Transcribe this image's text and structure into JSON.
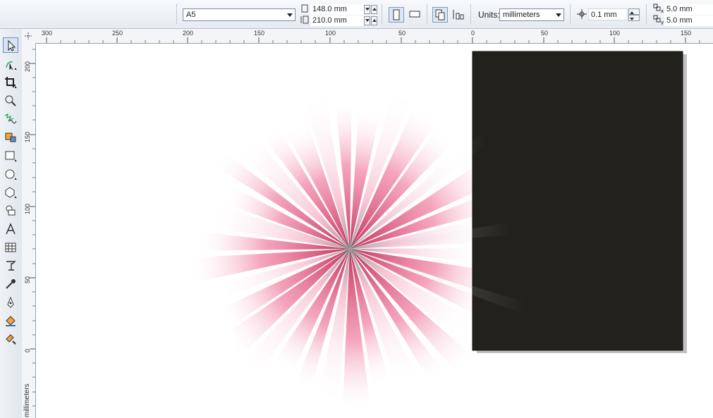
{
  "property_bar": {
    "paper_size": "A5",
    "page_width": "148.0 mm",
    "page_height": "210.0 mm",
    "units_label": "Units:",
    "units_value": "millimeters",
    "nudge_value": "0.1 mm",
    "duplicate_x": "5.0 mm",
    "duplicate_y": "5.0 mm"
  },
  "rulers": {
    "horizontal": [
      "300",
      "250",
      "200",
      "150",
      "100",
      "50",
      "0",
      "50",
      "100",
      "150"
    ],
    "vertical": [
      "200",
      "150",
      "100",
      "50",
      "0"
    ],
    "unit_label": "millimeters"
  },
  "toolbox": {
    "tools": [
      "pick-tool-icon",
      "shape-tool-icon",
      "crop-tool-icon",
      "zoom-tool-icon",
      "freehand-tool-icon",
      "smart-fill-tool-icon",
      "rectangle-tool-icon",
      "ellipse-tool-icon",
      "polygon-tool-icon",
      "basic-shapes-tool-icon",
      "text-tool-icon",
      "table-tool-icon",
      "interactive-tool-icon",
      "eyedropper-tool-icon",
      "outline-tool-icon",
      "fill-tool-icon",
      "interactive-fill-tool-icon"
    ]
  },
  "colors": {
    "page_fill": "#23211e",
    "burst_pink": "#e8467a",
    "canvas_bg": "#ffffff"
  }
}
